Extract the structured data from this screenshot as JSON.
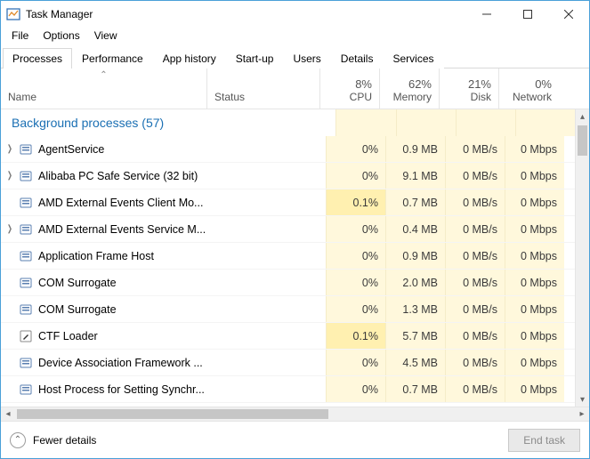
{
  "window": {
    "title": "Task Manager"
  },
  "menu": {
    "file": "File",
    "options": "Options",
    "view": "View"
  },
  "tabs": {
    "processes": "Processes",
    "performance": "Performance",
    "history": "App history",
    "startup": "Start-up",
    "users": "Users",
    "details": "Details",
    "services": "Services"
  },
  "columns": {
    "name": "Name",
    "status": "Status",
    "cpu_pct": "8%",
    "cpu": "CPU",
    "mem_pct": "62%",
    "mem": "Memory",
    "disk_pct": "21%",
    "disk": "Disk",
    "net_pct": "0%",
    "net": "Network"
  },
  "group": {
    "label": "Background processes (57)"
  },
  "rows": [
    {
      "expand": true,
      "icon": "svc",
      "name": "AgentService",
      "cpu": "0%",
      "cpu_h": 0,
      "mem": "0.9 MB",
      "disk": "0 MB/s",
      "net": "0 Mbps"
    },
    {
      "expand": true,
      "icon": "svc",
      "name": "Alibaba PC Safe Service (32 bit)",
      "cpu": "0%",
      "cpu_h": 0,
      "mem": "9.1 MB",
      "disk": "0 MB/s",
      "net": "0 Mbps"
    },
    {
      "expand": false,
      "icon": "svc",
      "name": "AMD External Events Client Mo...",
      "cpu": "0.1%",
      "cpu_h": 1,
      "mem": "0.7 MB",
      "disk": "0 MB/s",
      "net": "0 Mbps"
    },
    {
      "expand": true,
      "icon": "svc",
      "name": "AMD External Events Service M...",
      "cpu": "0%",
      "cpu_h": 0,
      "mem": "0.4 MB",
      "disk": "0 MB/s",
      "net": "0 Mbps"
    },
    {
      "expand": false,
      "icon": "svc",
      "name": "Application Frame Host",
      "cpu": "0%",
      "cpu_h": 0,
      "mem": "0.9 MB",
      "disk": "0 MB/s",
      "net": "0 Mbps"
    },
    {
      "expand": false,
      "icon": "svc",
      "name": "COM Surrogate",
      "cpu": "0%",
      "cpu_h": 0,
      "mem": "2.0 MB",
      "disk": "0 MB/s",
      "net": "0 Mbps"
    },
    {
      "expand": false,
      "icon": "svc",
      "name": "COM Surrogate",
      "cpu": "0%",
      "cpu_h": 0,
      "mem": "1.3 MB",
      "disk": "0 MB/s",
      "net": "0 Mbps"
    },
    {
      "expand": false,
      "icon": "pen",
      "name": "CTF Loader",
      "cpu": "0.1%",
      "cpu_h": 1,
      "mem": "5.7 MB",
      "disk": "0 MB/s",
      "net": "0 Mbps"
    },
    {
      "expand": false,
      "icon": "svc",
      "name": "Device Association Framework ...",
      "cpu": "0%",
      "cpu_h": 0,
      "mem": "4.5 MB",
      "disk": "0 MB/s",
      "net": "0 Mbps"
    },
    {
      "expand": false,
      "icon": "svc",
      "name": "Host Process for Setting Synchr...",
      "cpu": "0%",
      "cpu_h": 0,
      "mem": "0.7 MB",
      "disk": "0 MB/s",
      "net": "0 Mbps"
    }
  ],
  "footer": {
    "fewer": "Fewer details",
    "end": "End task"
  }
}
